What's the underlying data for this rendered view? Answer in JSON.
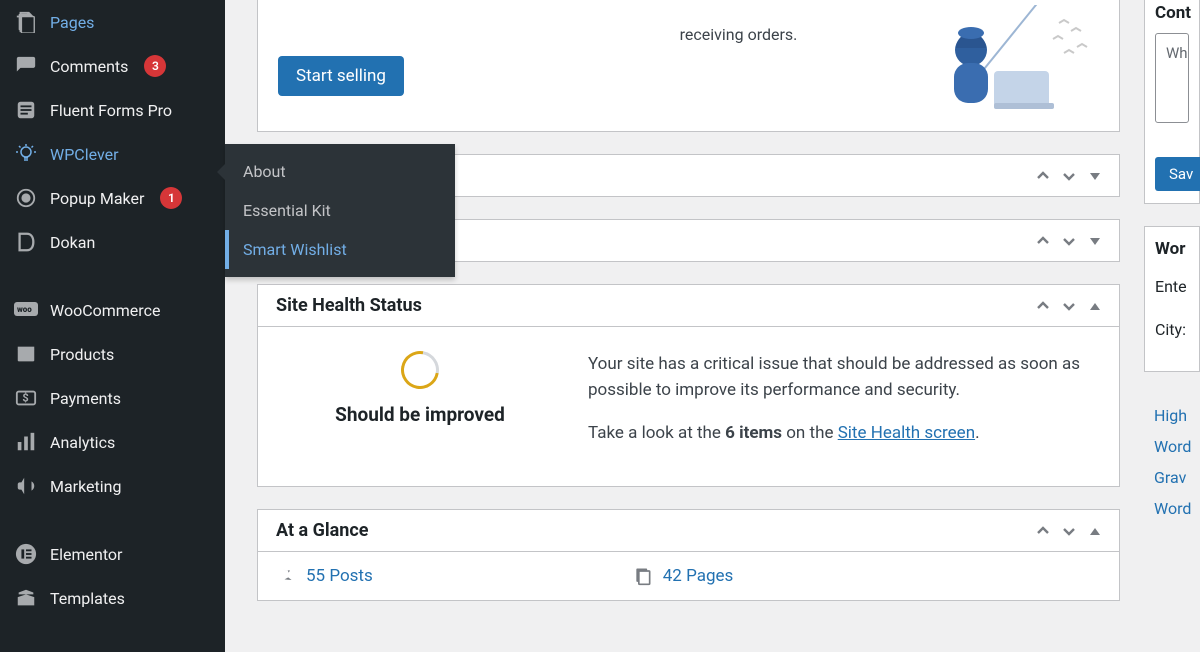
{
  "sidebar": {
    "items": [
      {
        "label": "Pages",
        "icon": "pages"
      },
      {
        "label": "Comments",
        "icon": "comment",
        "badge": "3"
      },
      {
        "label": "Fluent Forms Pro",
        "icon": "form"
      },
      {
        "label": "WPClever",
        "icon": "bulb",
        "active": true
      },
      {
        "label": "Popup Maker",
        "icon": "popup",
        "badge": "1"
      },
      {
        "label": "Dokan",
        "icon": "dokan"
      },
      {
        "label": "WooCommerce",
        "icon": "woo"
      },
      {
        "label": "Products",
        "icon": "products"
      },
      {
        "label": "Payments",
        "icon": "payments"
      },
      {
        "label": "Analytics",
        "icon": "analytics"
      },
      {
        "label": "Marketing",
        "icon": "marketing"
      },
      {
        "label": "Elementor",
        "icon": "elementor"
      },
      {
        "label": "Templates",
        "icon": "templates"
      }
    ]
  },
  "submenu": {
    "items": [
      {
        "label": "About"
      },
      {
        "label": "Essential Kit"
      },
      {
        "label": "Smart Wishlist",
        "active": true
      }
    ]
  },
  "hero": {
    "tail_text": "receiving orders.",
    "cta": "Start selling"
  },
  "collapsed_panels": [
    {
      "title_fragment": ""
    },
    {
      "title_fragment": ""
    }
  ],
  "site_health": {
    "title": "Site Health Status",
    "status": "Should be improved",
    "msg1": "Your site has a critical issue that should be addressed as soon as possible to improve its performance and security.",
    "msg2_pre": "Take a look at the ",
    "msg2_bold": "6 items",
    "msg2_mid": " on the ",
    "msg2_link": "Site Health screen",
    "msg2_post": "."
  },
  "glance": {
    "title": "At a Glance",
    "posts_count": "55 Posts",
    "pages_count": "42 Pages"
  },
  "rhs": {
    "card1": {
      "title": "Cont",
      "placeholder": "Wh",
      "save": "Sav"
    },
    "card2": {
      "title": "Wor",
      "label1": "Ente",
      "label2": "City:"
    },
    "card3": {
      "links": [
        "High",
        "Word",
        "Grav",
        "Word"
      ]
    }
  }
}
